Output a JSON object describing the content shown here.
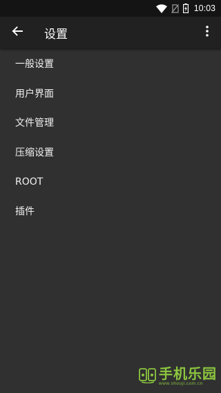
{
  "status_bar": {
    "time": "10:03",
    "icons": [
      "wifi-icon",
      "no-sim-icon",
      "battery-charging-icon"
    ]
  },
  "app_bar": {
    "back_icon": "arrow-left-icon",
    "title": "设置",
    "overflow_icon": "more-vert-icon"
  },
  "menu": {
    "items": [
      {
        "label": "一般设置"
      },
      {
        "label": "用户界面"
      },
      {
        "label": "文件管理"
      },
      {
        "label": "压缩设置"
      },
      {
        "label": "ROOT"
      },
      {
        "label": "插件"
      }
    ]
  },
  "watermark": {
    "main": "手机乐园",
    "sub": "www.shouji.com.cn"
  },
  "colors": {
    "background": "#303030",
    "app_bar": "#212121",
    "status_bar": "#141414",
    "watermark": "#8cc63f"
  }
}
